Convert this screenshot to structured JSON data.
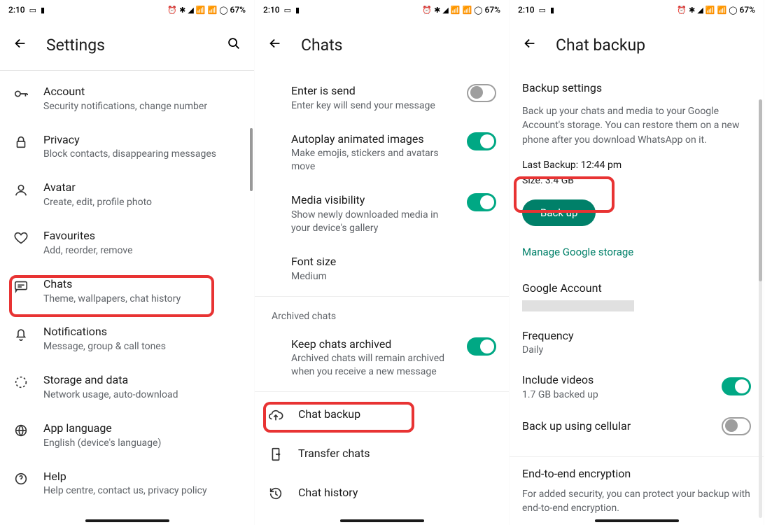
{
  "status_bar": {
    "time": "2:10",
    "battery": "67%"
  },
  "screen1": {
    "title": "Settings",
    "items": [
      {
        "icon": "key",
        "title": "Account",
        "sub": "Security notifications, change number"
      },
      {
        "icon": "lock",
        "title": "Privacy",
        "sub": "Block contacts, disappearing messages"
      },
      {
        "icon": "avatar",
        "title": "Avatar",
        "sub": "Create, edit, profile photo"
      },
      {
        "icon": "heart",
        "title": "Favourites",
        "sub": "Add, reorder, remove"
      },
      {
        "icon": "chat",
        "title": "Chats",
        "sub": "Theme, wallpapers, chat history"
      },
      {
        "icon": "bell",
        "title": "Notifications",
        "sub": "Message, group & call tones"
      },
      {
        "icon": "data",
        "title": "Storage and data",
        "sub": "Network usage, auto-download"
      },
      {
        "icon": "globe",
        "title": "App language",
        "sub": "English (device's language)"
      },
      {
        "icon": "help",
        "title": "Help",
        "sub": "Help centre, contact us, privacy policy"
      }
    ]
  },
  "screen2": {
    "title": "Chats",
    "items": [
      {
        "title": "Enter is send",
        "sub": "Enter key will send your message",
        "switch": "off"
      },
      {
        "title": "Autoplay animated images",
        "sub": "Make emojis, stickers and avatars move",
        "switch": "on"
      },
      {
        "title": "Media visibility",
        "sub": "Show newly downloaded media in your device's gallery",
        "switch": "on"
      },
      {
        "title": "Font size",
        "sub": "Medium"
      }
    ],
    "section_header": "Archived chats",
    "archived": {
      "title": "Keep chats archived",
      "sub": "Archived chats will remain archived when you receive a new message",
      "switch": "on"
    },
    "bottom": [
      {
        "icon": "cloud",
        "title": "Chat backup"
      },
      {
        "icon": "transfer",
        "title": "Transfer chats"
      },
      {
        "icon": "history",
        "title": "Chat history"
      }
    ]
  },
  "screen3": {
    "title": "Chat backup",
    "heading": "Backup settings",
    "description": "Back up your chats and media to your Google Account's storage. You can restore them on a new phone after you download WhatsApp on it.",
    "last_backup_label": "Last Backup: 12:44 pm",
    "size_label": "Size: 3.4 GB",
    "backup_button": "Back up",
    "manage_link": "Manage Google storage",
    "google_account_label": "Google Account",
    "frequency_label": "Frequency",
    "frequency_value": "Daily",
    "videos_label": "Include videos",
    "videos_sub": "1.7 GB backed up",
    "cellular_label": "Back up using cellular",
    "e2e_heading": "End-to-end encryption",
    "e2e_desc": "For added security, you can protect your backup with end-to-end encryption."
  }
}
